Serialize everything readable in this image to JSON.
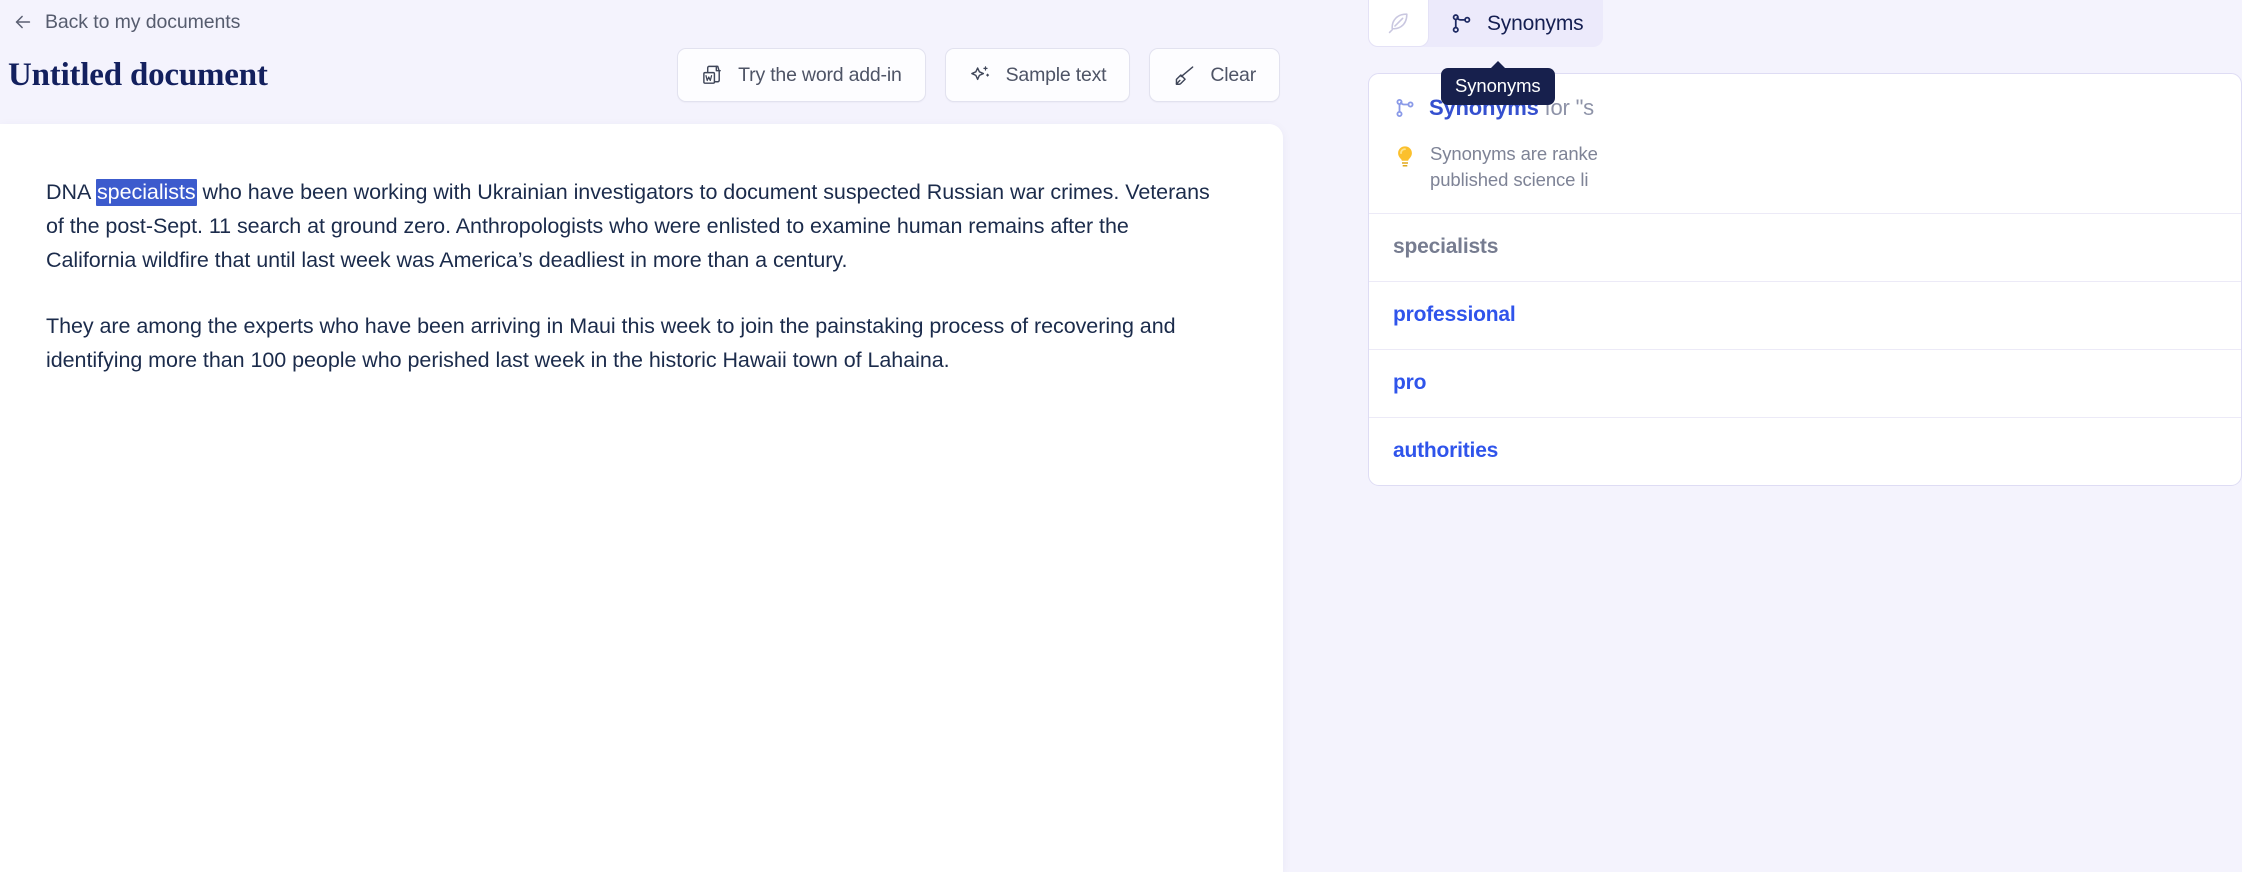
{
  "theme": {
    "page_bg": "#f4f3fd",
    "sheet_bg": "#ffffff",
    "title_color": "#13205e",
    "body_text_color": "#1b2b4b",
    "selection_bg": "#3c5bcd",
    "accent_blue": "#2f54eb",
    "tooltip_bg": "#17204d"
  },
  "header": {
    "back_link": "Back to my documents",
    "back_icon": "arrow-left-icon",
    "document_title": "Untitled document"
  },
  "toolbar": {
    "buttons": [
      {
        "label": "Try the word add-in",
        "icon": "word-document-icon"
      },
      {
        "label": "Sample text",
        "icon": "sparkle-star-icon"
      },
      {
        "label": "Clear",
        "icon": "eraser-brush-icon"
      }
    ]
  },
  "document": {
    "selected_word": "specialists",
    "paragraphs": [
      {
        "before_selection": "DNA ",
        "selection": "specialists",
        "after_selection": " who have been working with Ukrainian investigators to document suspected Russian war crimes. Veterans of the post-Sept. 11 search at ground zero. Anthropologists who were enlisted to examine human remains after the California wildfire that until last week was America’s deadliest in more than a century."
      },
      {
        "text": "They are among the experts who have been arriving in Maui this week to join the painstaking process of recovering and identifying more than 100 people who perished last week in the historic Hawaii town of Lahaina."
      }
    ]
  },
  "right_panel": {
    "tabs": [
      {
        "label": "",
        "icon": "feather-quill-icon",
        "active": true
      },
      {
        "label": "Synonyms",
        "icon": "git-branch-icon",
        "active": false
      }
    ],
    "tooltip": "Synonyms",
    "card": {
      "heading_icon": "git-branch-icon",
      "heading_strong": "Synonyms",
      "heading_rest": " for \"s",
      "hint_icon": "lightbulb-icon",
      "hint_line_1": "Synonyms are ranke",
      "hint_line_2": "published science li",
      "items": [
        {
          "label": "specialists",
          "kind": "current"
        },
        {
          "label": "professional",
          "kind": "link"
        },
        {
          "label": "pro",
          "kind": "link"
        },
        {
          "label": "authorities",
          "kind": "link"
        }
      ]
    }
  }
}
